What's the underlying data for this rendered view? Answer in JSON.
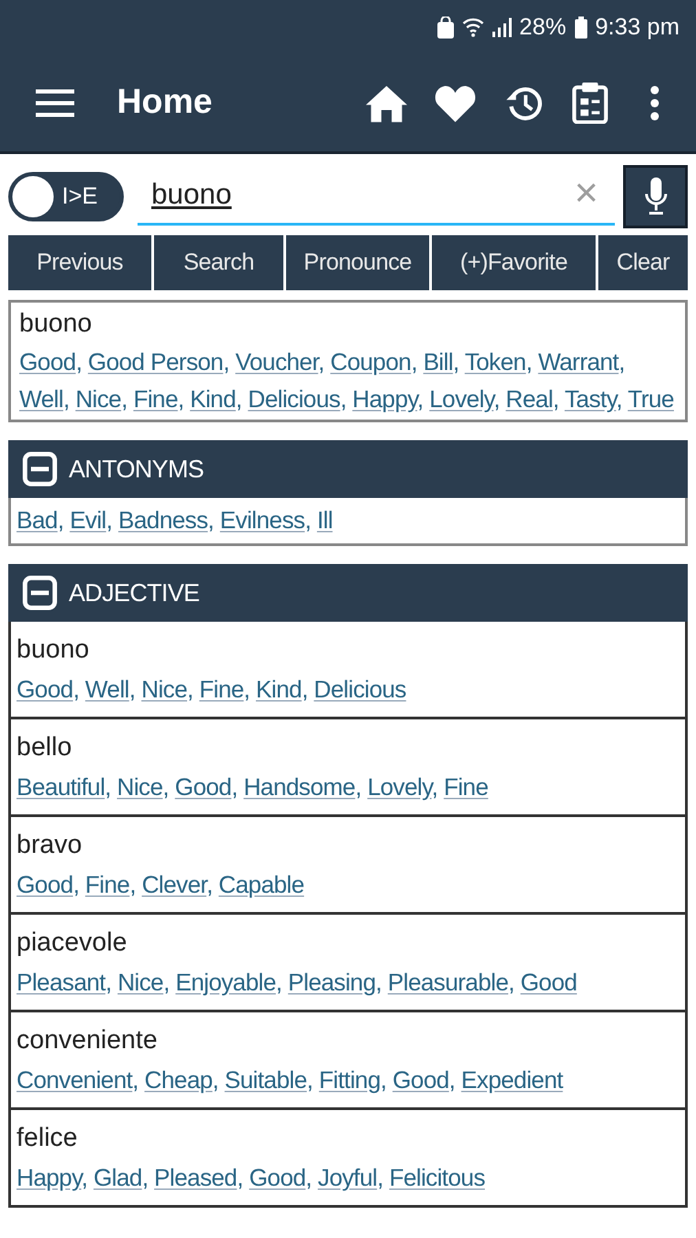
{
  "status_bar": {
    "battery": "28%",
    "time": "9:33 pm"
  },
  "toolbar": {
    "title": "Home"
  },
  "search": {
    "toggle": {
      "label": "I>E",
      "on": false
    },
    "value": "buono",
    "clear": "×"
  },
  "separator": ",",
  "buttons": [
    "Previous",
    "Search",
    "Pronounce",
    "(+)Favorite",
    "Clear"
  ],
  "result": {
    "word": "buono",
    "synonyms": [
      "Good",
      "Good Person",
      "Voucher",
      "Coupon",
      "Bill",
      "Token",
      "Warrant",
      "Well",
      "Nice",
      "Fine",
      "Kind",
      "Delicious",
      "Happy",
      "Lovely",
      "Real",
      "Tasty",
      "True"
    ]
  },
  "sections": [
    {
      "title": "ANTONYMS",
      "expanded": true,
      "kind": "list",
      "words": [
        "Bad",
        "Evil",
        "Badness",
        "Evilness",
        "Ill"
      ]
    },
    {
      "title": "ADJECTIVE",
      "expanded": true,
      "kind": "entries",
      "entries": [
        {
          "word": "buono",
          "synonyms": [
            "Good",
            "Well",
            "Nice",
            "Fine",
            "Kind",
            "Delicious"
          ]
        },
        {
          "word": "bello",
          "synonyms": [
            "Beautiful",
            "Nice",
            "Good",
            "Handsome",
            "Lovely",
            "Fine"
          ]
        },
        {
          "word": "bravo",
          "synonyms": [
            "Good",
            "Fine",
            "Clever",
            "Capable"
          ]
        },
        {
          "word": "piacevole",
          "synonyms": [
            "Pleasant",
            "Nice",
            "Enjoyable",
            "Pleasing",
            "Pleasurable",
            "Good"
          ]
        },
        {
          "word": "conveniente",
          "synonyms": [
            "Convenient",
            "Cheap",
            "Suitable",
            "Fitting",
            "Good",
            "Expedient"
          ]
        },
        {
          "word": "felice",
          "synonyms": [
            "Happy",
            "Glad",
            "Pleased",
            "Good",
            "Joyful",
            "Felicitous"
          ]
        }
      ]
    }
  ]
}
